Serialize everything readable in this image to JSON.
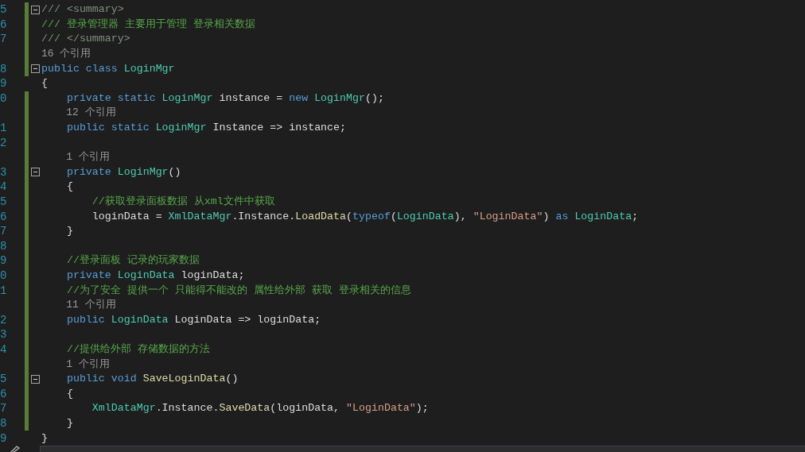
{
  "editor": {
    "rows": [
      {
        "kind": "code",
        "number": "5",
        "changed": true,
        "fold": true,
        "tokens": [
          {
            "kind": "doc",
            "text": "/// <summary>"
          }
        ]
      },
      {
        "kind": "code",
        "number": "6",
        "changed": true,
        "fold": false,
        "tokens": [
          {
            "kind": "comment",
            "text": "/// 登录管理器 主要用于管理 登录相关数据"
          }
        ]
      },
      {
        "kind": "code",
        "number": "7",
        "changed": true,
        "fold": false,
        "tokens": [
          {
            "kind": "doc",
            "text": "/// </summary>"
          }
        ]
      },
      {
        "kind": "lens",
        "changed": true,
        "fold": false,
        "tokens": [
          {
            "kind": "lens",
            "text": "16 个引用"
          }
        ]
      },
      {
        "kind": "code",
        "number": "8",
        "changed": true,
        "fold": true,
        "tokens": [
          {
            "kind": "keyword",
            "text": "public class "
          },
          {
            "kind": "type",
            "text": "LoginMgr"
          }
        ]
      },
      {
        "kind": "code",
        "number": "9",
        "changed": false,
        "fold": false,
        "tokens": [
          {
            "kind": "plain",
            "text": "{"
          }
        ]
      },
      {
        "kind": "code",
        "number": "0",
        "changed": true,
        "fold": false,
        "tokens": [
          {
            "kind": "keyword",
            "text": "    private static "
          },
          {
            "kind": "type",
            "text": "LoginMgr"
          },
          {
            "kind": "plain",
            "text": " instance = "
          },
          {
            "kind": "keyword",
            "text": "new "
          },
          {
            "kind": "type",
            "text": "LoginMgr"
          },
          {
            "kind": "plain",
            "text": "();"
          }
        ]
      },
      {
        "kind": "lens",
        "changed": true,
        "fold": false,
        "tokens": [
          {
            "kind": "lens",
            "text": "    12 个引用"
          }
        ]
      },
      {
        "kind": "code",
        "number": "1",
        "changed": true,
        "fold": false,
        "tokens": [
          {
            "kind": "keyword",
            "text": "    public static "
          },
          {
            "kind": "type",
            "text": "LoginMgr"
          },
          {
            "kind": "plain",
            "text": " Instance => instance;"
          }
        ]
      },
      {
        "kind": "code",
        "number": "2",
        "changed": true,
        "fold": false
      },
      {
        "kind": "lens",
        "changed": true,
        "fold": false,
        "tokens": [
          {
            "kind": "lens",
            "text": "    1 个引用"
          }
        ]
      },
      {
        "kind": "code",
        "number": "3",
        "changed": true,
        "fold": true,
        "tokens": [
          {
            "kind": "keyword",
            "text": "    private "
          },
          {
            "kind": "type",
            "text": "LoginMgr"
          },
          {
            "kind": "plain",
            "text": "()"
          }
        ]
      },
      {
        "kind": "code",
        "number": "4",
        "changed": true,
        "fold": false,
        "tokens": [
          {
            "kind": "plain",
            "text": "    {"
          }
        ]
      },
      {
        "kind": "code",
        "number": "5",
        "changed": true,
        "fold": false,
        "tokens": [
          {
            "kind": "comment",
            "text": "        //获取登录面板数据 从xml文件中获取"
          }
        ]
      },
      {
        "kind": "code",
        "number": "6",
        "changed": true,
        "fold": false,
        "tokens": [
          {
            "kind": "plain",
            "text": "        loginData = "
          },
          {
            "kind": "type",
            "text": "XmlDataMgr"
          },
          {
            "kind": "plain",
            "text": ".Instance."
          },
          {
            "kind": "method",
            "text": "LoadData"
          },
          {
            "kind": "plain",
            "text": "("
          },
          {
            "kind": "keyword",
            "text": "typeof"
          },
          {
            "kind": "plain",
            "text": "("
          },
          {
            "kind": "type",
            "text": "LoginData"
          },
          {
            "kind": "plain",
            "text": "), "
          },
          {
            "kind": "string",
            "text": "\"LoginData\""
          },
          {
            "kind": "plain",
            "text": ") "
          },
          {
            "kind": "keyword",
            "text": "as "
          },
          {
            "kind": "type",
            "text": "LoginData"
          },
          {
            "kind": "plain",
            "text": ";"
          }
        ]
      },
      {
        "kind": "code",
        "number": "7",
        "changed": true,
        "fold": false,
        "tokens": [
          {
            "kind": "plain",
            "text": "    }"
          }
        ]
      },
      {
        "kind": "code",
        "number": "8",
        "changed": true,
        "fold": false
      },
      {
        "kind": "code",
        "number": "9",
        "changed": true,
        "fold": false,
        "tokens": [
          {
            "kind": "comment",
            "text": "    //登录面板 记录的玩家数据"
          }
        ]
      },
      {
        "kind": "code",
        "number": "0",
        "changed": true,
        "fold": false,
        "tokens": [
          {
            "kind": "keyword",
            "text": "    private "
          },
          {
            "kind": "type",
            "text": "LoginData"
          },
          {
            "kind": "plain",
            "text": " loginData;"
          }
        ]
      },
      {
        "kind": "code",
        "number": "1",
        "changed": true,
        "fold": false,
        "tokens": [
          {
            "kind": "comment",
            "text": "    //为了安全 提供一个 只能得不能改的 属性给外部 获取 登录相关的信息"
          }
        ]
      },
      {
        "kind": "lens",
        "changed": true,
        "fold": false,
        "tokens": [
          {
            "kind": "lens",
            "text": "    11 个引用"
          }
        ]
      },
      {
        "kind": "code",
        "number": "2",
        "changed": true,
        "fold": false,
        "tokens": [
          {
            "kind": "keyword",
            "text": "    public "
          },
          {
            "kind": "type",
            "text": "LoginData"
          },
          {
            "kind": "plain",
            "text": " LoginData => loginData;"
          }
        ]
      },
      {
        "kind": "code",
        "number": "3",
        "changed": true,
        "fold": false
      },
      {
        "kind": "code",
        "number": "4",
        "changed": true,
        "fold": false,
        "tokens": [
          {
            "kind": "comment",
            "text": "    //提供给外部 存储数据的方法"
          }
        ]
      },
      {
        "kind": "lens",
        "changed": true,
        "fold": false,
        "tokens": [
          {
            "kind": "lens",
            "text": "    1 个引用"
          }
        ]
      },
      {
        "kind": "code",
        "number": "5",
        "changed": true,
        "fold": true,
        "tokens": [
          {
            "kind": "keyword",
            "text": "    public void "
          },
          {
            "kind": "method",
            "text": "SaveLoginData"
          },
          {
            "kind": "plain",
            "text": "()"
          }
        ]
      },
      {
        "kind": "code",
        "number": "6",
        "changed": true,
        "fold": false,
        "tokens": [
          {
            "kind": "plain",
            "text": "    {"
          }
        ]
      },
      {
        "kind": "code",
        "number": "7",
        "changed": true,
        "fold": false,
        "tokens": [
          {
            "kind": "type",
            "text": "        XmlDataMgr"
          },
          {
            "kind": "plain",
            "text": ".Instance."
          },
          {
            "kind": "method",
            "text": "SaveData"
          },
          {
            "kind": "plain",
            "text": "(loginData, "
          },
          {
            "kind": "string",
            "text": "\"LoginData\""
          },
          {
            "kind": "plain",
            "text": ");"
          }
        ]
      },
      {
        "kind": "code",
        "number": "8",
        "changed": true,
        "fold": false,
        "tokens": [
          {
            "kind": "plain",
            "text": "    }"
          }
        ]
      },
      {
        "kind": "code",
        "number": "9",
        "changed": false,
        "fold": false,
        "tokens": [
          {
            "kind": "plain",
            "text": "}"
          }
        ]
      }
    ]
  }
}
